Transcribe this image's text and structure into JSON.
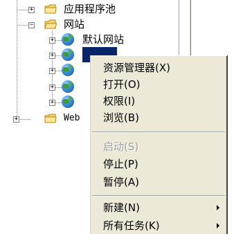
{
  "tree": {
    "app_pools": "应用程序池",
    "websites": "网站",
    "default_site": "默认网站",
    "selected_site": "",
    "web_ext": "Web"
  },
  "context_menu": {
    "items": [
      {
        "label": "资源管理器(X)",
        "enabled": true
      },
      {
        "label": "打开(O)",
        "enabled": true
      },
      {
        "label": "权限(I)",
        "enabled": true
      },
      {
        "label": "浏览(B)",
        "enabled": true
      },
      {
        "label": "启动(S)",
        "enabled": false
      },
      {
        "label": "停止(P)",
        "enabled": true
      },
      {
        "label": "暂停(A)",
        "enabled": true
      },
      {
        "label": "新建(N)",
        "enabled": true,
        "submenu": true
      },
      {
        "label": "所有任务(K)",
        "enabled": true,
        "submenu": true
      }
    ]
  },
  "colors": {
    "selection": "#0a246a",
    "menu_bg": "#ece9d8",
    "disabled_text": "#a0a0a0"
  }
}
